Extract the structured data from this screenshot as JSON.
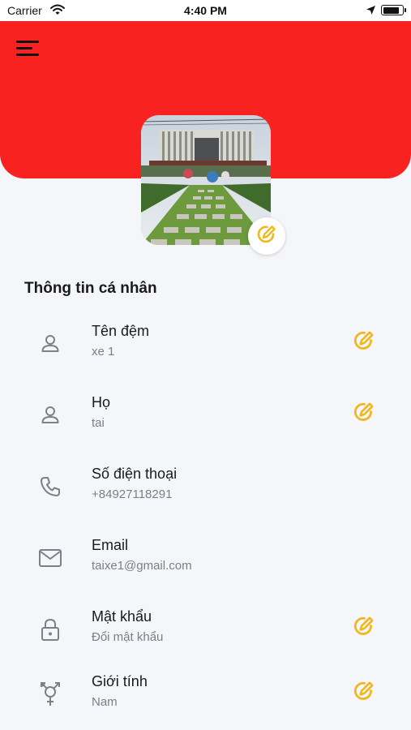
{
  "status_bar": {
    "carrier": "Carrier",
    "time": "4:40 PM",
    "battery_level": 0.9
  },
  "colors": {
    "header": "#f82220",
    "accent_edit": "#f0b81c",
    "icon_gray": "#7d8087"
  },
  "header": {
    "menu_icon": "hamburger-menu-icon"
  },
  "profile": {
    "avatar_description_icon": "building-garden-photo",
    "avatar_edit_icon": "edit-pencil-icon"
  },
  "section": {
    "title": "Thông tin cá nhân"
  },
  "fields": [
    {
      "icon": "person-icon",
      "label": "Tên đệm",
      "value": "xe 1",
      "editable": true
    },
    {
      "icon": "person-icon",
      "label": "Họ",
      "value": "tai",
      "editable": true
    },
    {
      "icon": "phone-icon",
      "label": "Số điện thoại",
      "value": "+84927118291",
      "editable": false
    },
    {
      "icon": "mail-icon",
      "label": "Email",
      "value": "taixe1@gmail.com",
      "editable": false
    },
    {
      "icon": "lock-icon",
      "label": "Mật khẩu",
      "value": "Đổi mật khẩu",
      "editable": true
    },
    {
      "icon": "gender-icon",
      "label": "Giới tính",
      "value": "Nam",
      "editable": true
    }
  ]
}
